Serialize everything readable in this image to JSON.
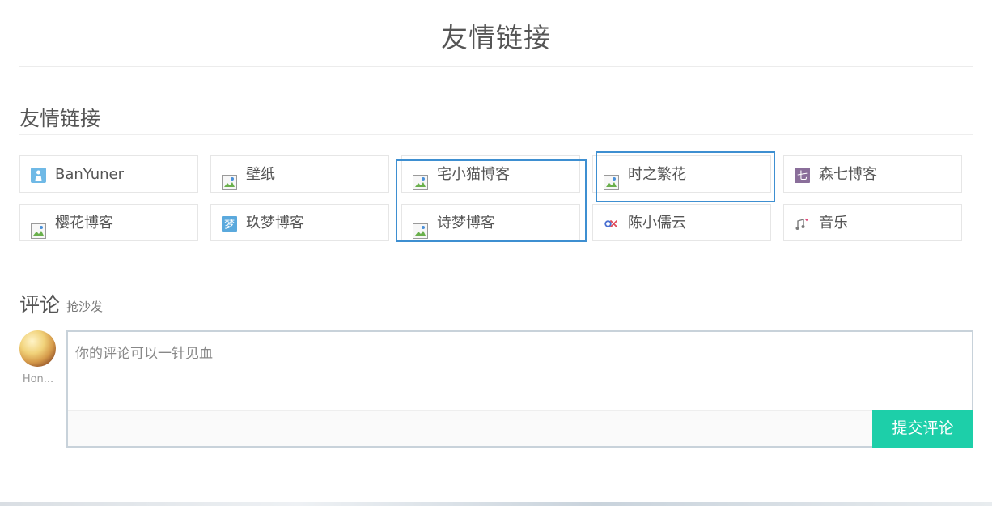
{
  "page": {
    "title": "友情链接"
  },
  "links_section": {
    "title": "友情链接",
    "links": [
      {
        "label": "BanYuner",
        "icon": "person-icon",
        "icon_state": "loaded"
      },
      {
        "label": "壁纸",
        "icon": "broken-image-icon",
        "icon_state": "broken"
      },
      {
        "label": "宅小猫博客",
        "icon": "broken-image-icon",
        "icon_state": "broken"
      },
      {
        "label": "时之繁花",
        "icon": "broken-image-icon",
        "icon_state": "broken"
      },
      {
        "label": "森七博客",
        "icon": "seven-char-icon",
        "icon_state": "loaded",
        "icon_glyph": "七"
      },
      {
        "label": "樱花博客",
        "icon": "broken-image-icon",
        "icon_state": "broken"
      },
      {
        "label": "玖梦博客",
        "icon": "meng-char-icon",
        "icon_state": "loaded",
        "icon_glyph": "梦"
      },
      {
        "label": "诗梦博客",
        "icon": "broken-image-icon",
        "icon_state": "broken"
      },
      {
        "label": "陈小儒云",
        "icon": "infinity-logo-icon",
        "icon_state": "loaded"
      },
      {
        "label": "音乐",
        "icon": "music-note-icon",
        "icon_state": "loaded"
      }
    ]
  },
  "comments": {
    "title": "评论",
    "subtitle": "抢沙发",
    "user_name": "Hon...",
    "input_placeholder": "你的评论可以一针见血",
    "submit_label": "提交评论"
  },
  "colors": {
    "accent_highlight": "#3e8fd1",
    "submit_button": "#1dcfa9",
    "text": "#555555"
  }
}
